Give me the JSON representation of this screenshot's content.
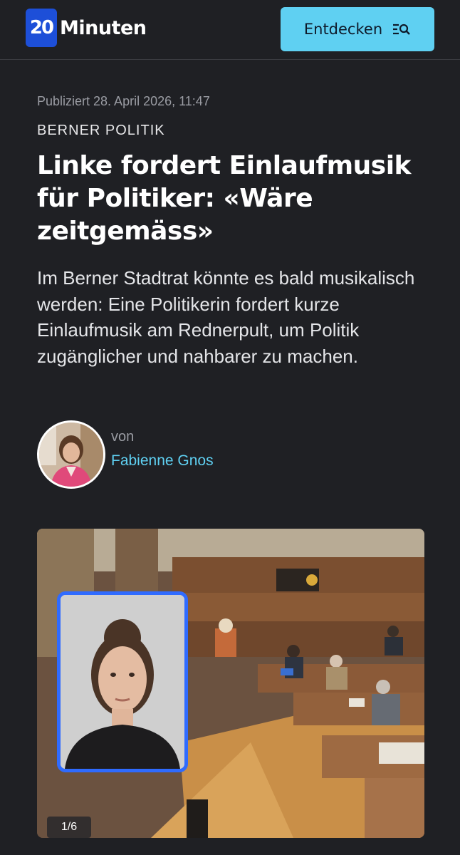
{
  "header": {
    "logo_mark": "20",
    "logo_text": "Minuten",
    "discover_label": "Entdecken",
    "discover_icon": "search-list-icon"
  },
  "article": {
    "published": "Publiziert 28. April 2026, 11:47",
    "category": "BERNER POLITIK",
    "title": "Linke fordert Einlaufmusik für Politiker: «Wäre zeitgemäss»",
    "lead": "Im Berner Stadtrat könnte es bald musikalisch werden: Eine Politikerin fordert kurze Einlaufmusik am Rednerpult, um Politik zugänglicher und nahbarer zu machen."
  },
  "author": {
    "by": "von",
    "name": "Fabienne Gnos"
  },
  "gallery": {
    "counter": "1/6"
  },
  "colors": {
    "background": "#1f2024",
    "accent": "#5fd0f2",
    "logo_blue": "#1d4fd8",
    "inset_border": "#2f6bff"
  }
}
